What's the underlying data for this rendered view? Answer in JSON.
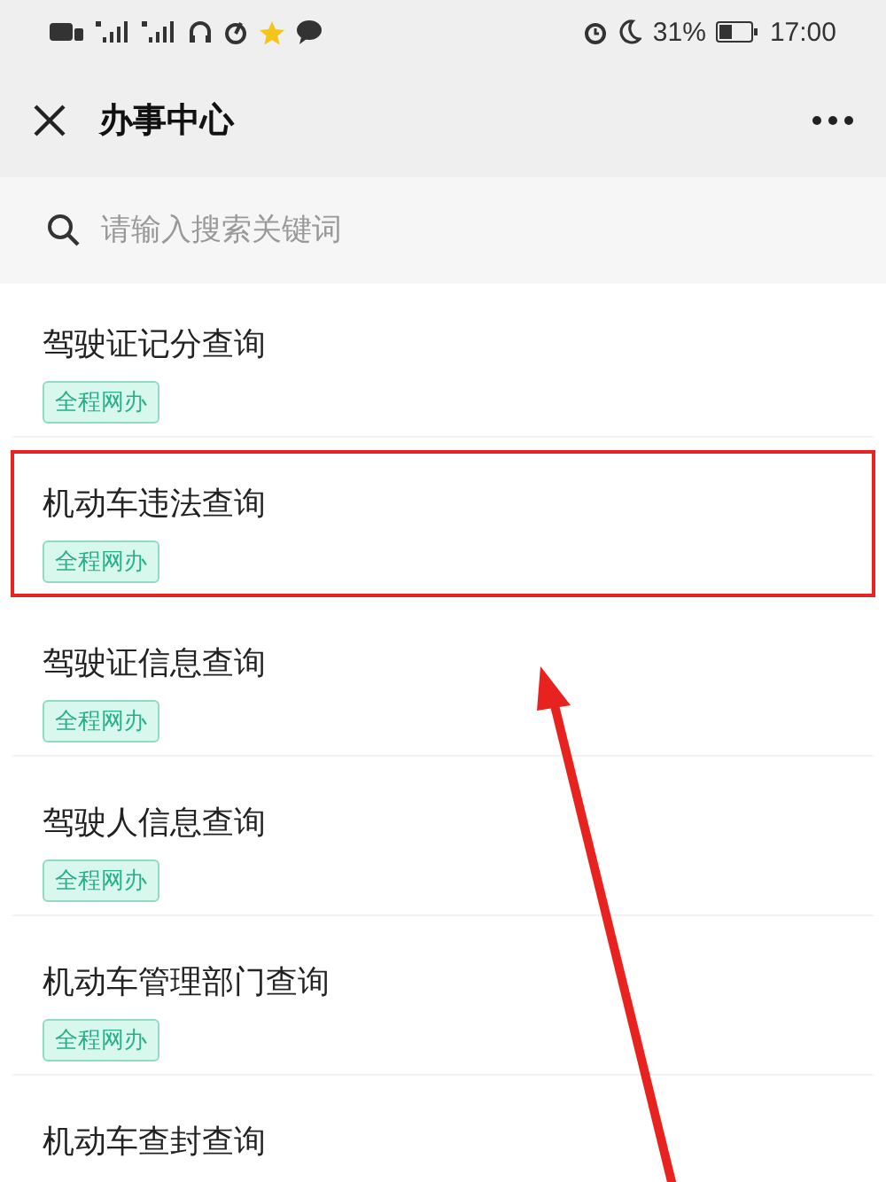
{
  "status_bar": {
    "battery_text": "31%",
    "time": "17:00"
  },
  "nav": {
    "title": "办事中心"
  },
  "search": {
    "placeholder": "请输入搜索关键词"
  },
  "items": [
    {
      "title": "驾驶证记分查询",
      "tag": "全程网办",
      "highlighted": false
    },
    {
      "title": "机动车违法查询",
      "tag": "全程网办",
      "highlighted": true
    },
    {
      "title": "驾驶证信息查询",
      "tag": "全程网办",
      "highlighted": false
    },
    {
      "title": "驾驶人信息查询",
      "tag": "全程网办",
      "highlighted": false
    },
    {
      "title": "机动车管理部门查询",
      "tag": "全程网办",
      "highlighted": false
    },
    {
      "title": "机动车查封查询",
      "highlighted": false
    }
  ]
}
